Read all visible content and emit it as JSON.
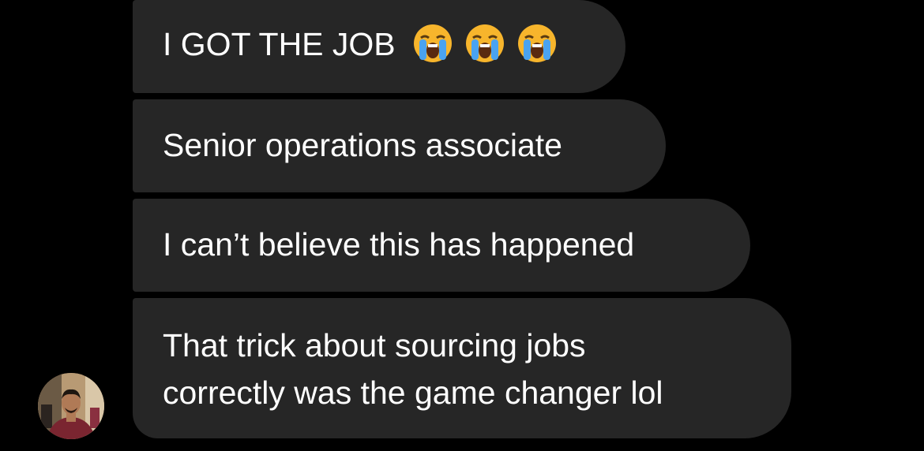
{
  "conversation": {
    "messages": [
      {
        "text": "I GOT THE JOB",
        "emojis": [
          "loudly-crying-face-emoji",
          "loudly-crying-face-emoji",
          "loudly-crying-face-emoji"
        ]
      },
      {
        "text": "Senior operations associate"
      },
      {
        "text": "I can’t believe this has happened"
      },
      {
        "lines": [
          "That trick about sourcing jobs",
          "correctly was the game changer lol"
        ]
      }
    ],
    "sender_avatar": "profile-photo"
  },
  "colors": {
    "background": "#000000",
    "bubble": "#262626",
    "text": "#ffffff",
    "emoji_face": "#f7b52c",
    "emoji_tears": "#4aa3f0"
  }
}
